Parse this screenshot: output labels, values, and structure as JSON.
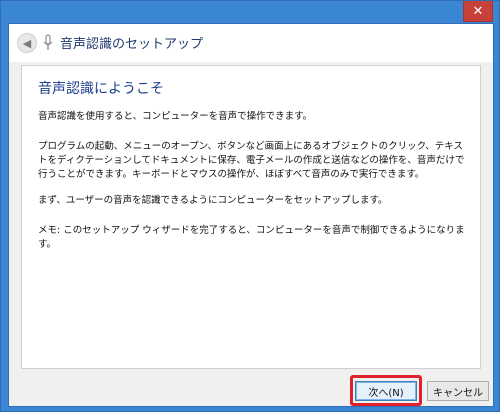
{
  "window": {
    "title": "音声認識のセットアップ",
    "close_glyph": "✕"
  },
  "header": {
    "back_glyph": "◀",
    "mic_icon": "microphone-icon"
  },
  "content": {
    "heading": "音声認識にようこそ",
    "paragraphs": [
      "音声認識を使用すると、コンピューターを音声で操作できます。",
      "プログラムの起動、メニューのオープン、ボタンなど画面上にあるオブジェクトのクリック、テキストをディクテーションしてドキュメントに保存、電子メールの作成と送信などの操作を、音声だけで行うことができます。キーボードとマウスの操作が、ほぼすべて音声のみで実行できます。",
      "まず、ユーザーの音声を認識できるようにコンピューターをセットアップします。",
      "メモ: このセットアップ ウィザードを完了すると、コンピューターを音声で制御できるようになります。"
    ]
  },
  "footer": {
    "next_label": "次へ(N)",
    "cancel_label": "キャンセル"
  },
  "colors": {
    "frame": "#3a86d4",
    "heading": "#1b3f8f",
    "highlight": "#e0202a",
    "close": "#c7403a"
  }
}
